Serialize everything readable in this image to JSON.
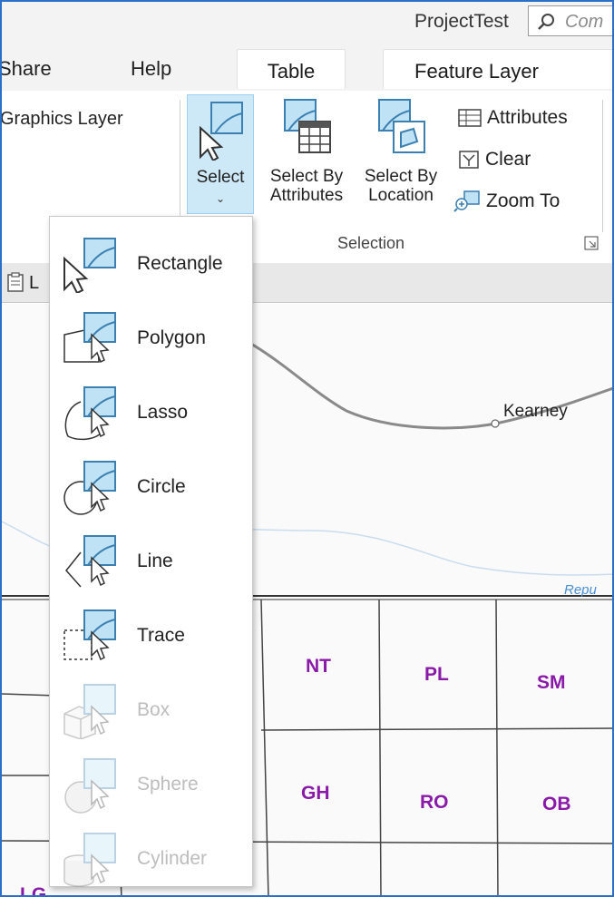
{
  "titlebar": {
    "project_title": "ProjectTest",
    "search_placeholder": "Com"
  },
  "tabs": {
    "share": "Share",
    "help": "Help",
    "table": "Table",
    "feature_layer": "Feature Layer"
  },
  "ribbon": {
    "graphics_layer": "Graphics Layer",
    "select": "Select",
    "select_by_attributes_line1": "Select By",
    "select_by_attributes_line2": "Attributes",
    "select_by_location_line1": "Select By",
    "select_by_location_line2": "Location",
    "attributes": "Attributes",
    "clear": "Clear",
    "zoom_to": "Zoom To",
    "group_label": "Selection"
  },
  "strip": {
    "tab_letter": "L"
  },
  "dropdown": {
    "items": [
      {
        "label": "Rectangle",
        "icon": "rectangle-select-icon",
        "enabled": true
      },
      {
        "label": "Polygon",
        "icon": "polygon-select-icon",
        "enabled": true
      },
      {
        "label": "Lasso",
        "icon": "lasso-select-icon",
        "enabled": true
      },
      {
        "label": "Circle",
        "icon": "circle-select-icon",
        "enabled": true
      },
      {
        "label": "Line",
        "icon": "line-select-icon",
        "enabled": true
      },
      {
        "label": "Trace",
        "icon": "trace-select-icon",
        "enabled": true
      },
      {
        "label": "Box",
        "icon": "box-select-icon",
        "enabled": false
      },
      {
        "label": "Sphere",
        "icon": "sphere-select-icon",
        "enabled": false
      },
      {
        "label": "Cylinder",
        "icon": "cylinder-select-icon",
        "enabled": false
      }
    ]
  },
  "map": {
    "city": "Kearney",
    "river": "Repu",
    "counties": [
      "NT",
      "PL",
      "SM",
      "GH",
      "RO",
      "OB",
      "LG"
    ]
  },
  "colors": {
    "accent": "#2b6fc9",
    "select_highlight": "#cde8f7",
    "county_label": "#8a1aa8",
    "river": "#4a8fd4"
  }
}
